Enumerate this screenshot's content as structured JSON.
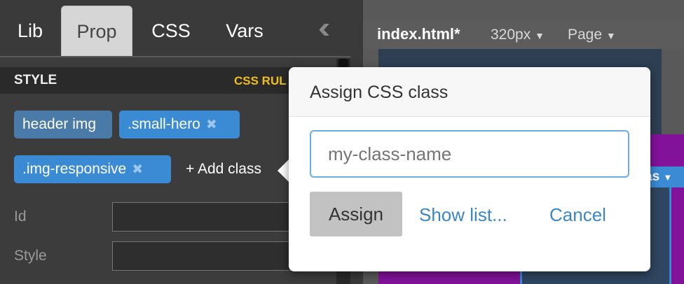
{
  "left_panel": {
    "tabs": [
      {
        "label": "Lib"
      },
      {
        "label": "Prop"
      },
      {
        "label": "CSS"
      },
      {
        "label": "Vars"
      }
    ],
    "active_tab": "Prop",
    "collapse_icon": "double-chevron-left-icon",
    "style_section_title": "STYLE",
    "css_rules_label": "CSS RUL",
    "class_tags": [
      {
        "label": "header img",
        "removable": false
      },
      {
        "label": ".small-hero",
        "removable": true
      },
      {
        "label": ".img-responsive",
        "removable": true
      }
    ],
    "add_class_label": "+ Add class",
    "fields": [
      {
        "label": "Id",
        "value": ""
      },
      {
        "label": "Style",
        "value": ""
      }
    ]
  },
  "document": {
    "filename": "index.html*",
    "width_option": "320px",
    "page_option": "Page",
    "side_tag": "as"
  },
  "popover": {
    "title": "Assign CSS class",
    "input_placeholder": "my-class-name",
    "input_value": "",
    "assign_label": "Assign",
    "show_list_label": "Show list...",
    "cancel_label": "Cancel"
  },
  "colors": {
    "tag_blue": "#3b8bd4",
    "tag_dark": "#4a7aa8",
    "css_rules_yellow": "#f0c018",
    "link_blue": "#3b87c6",
    "canvas_purple": "#82129a"
  }
}
